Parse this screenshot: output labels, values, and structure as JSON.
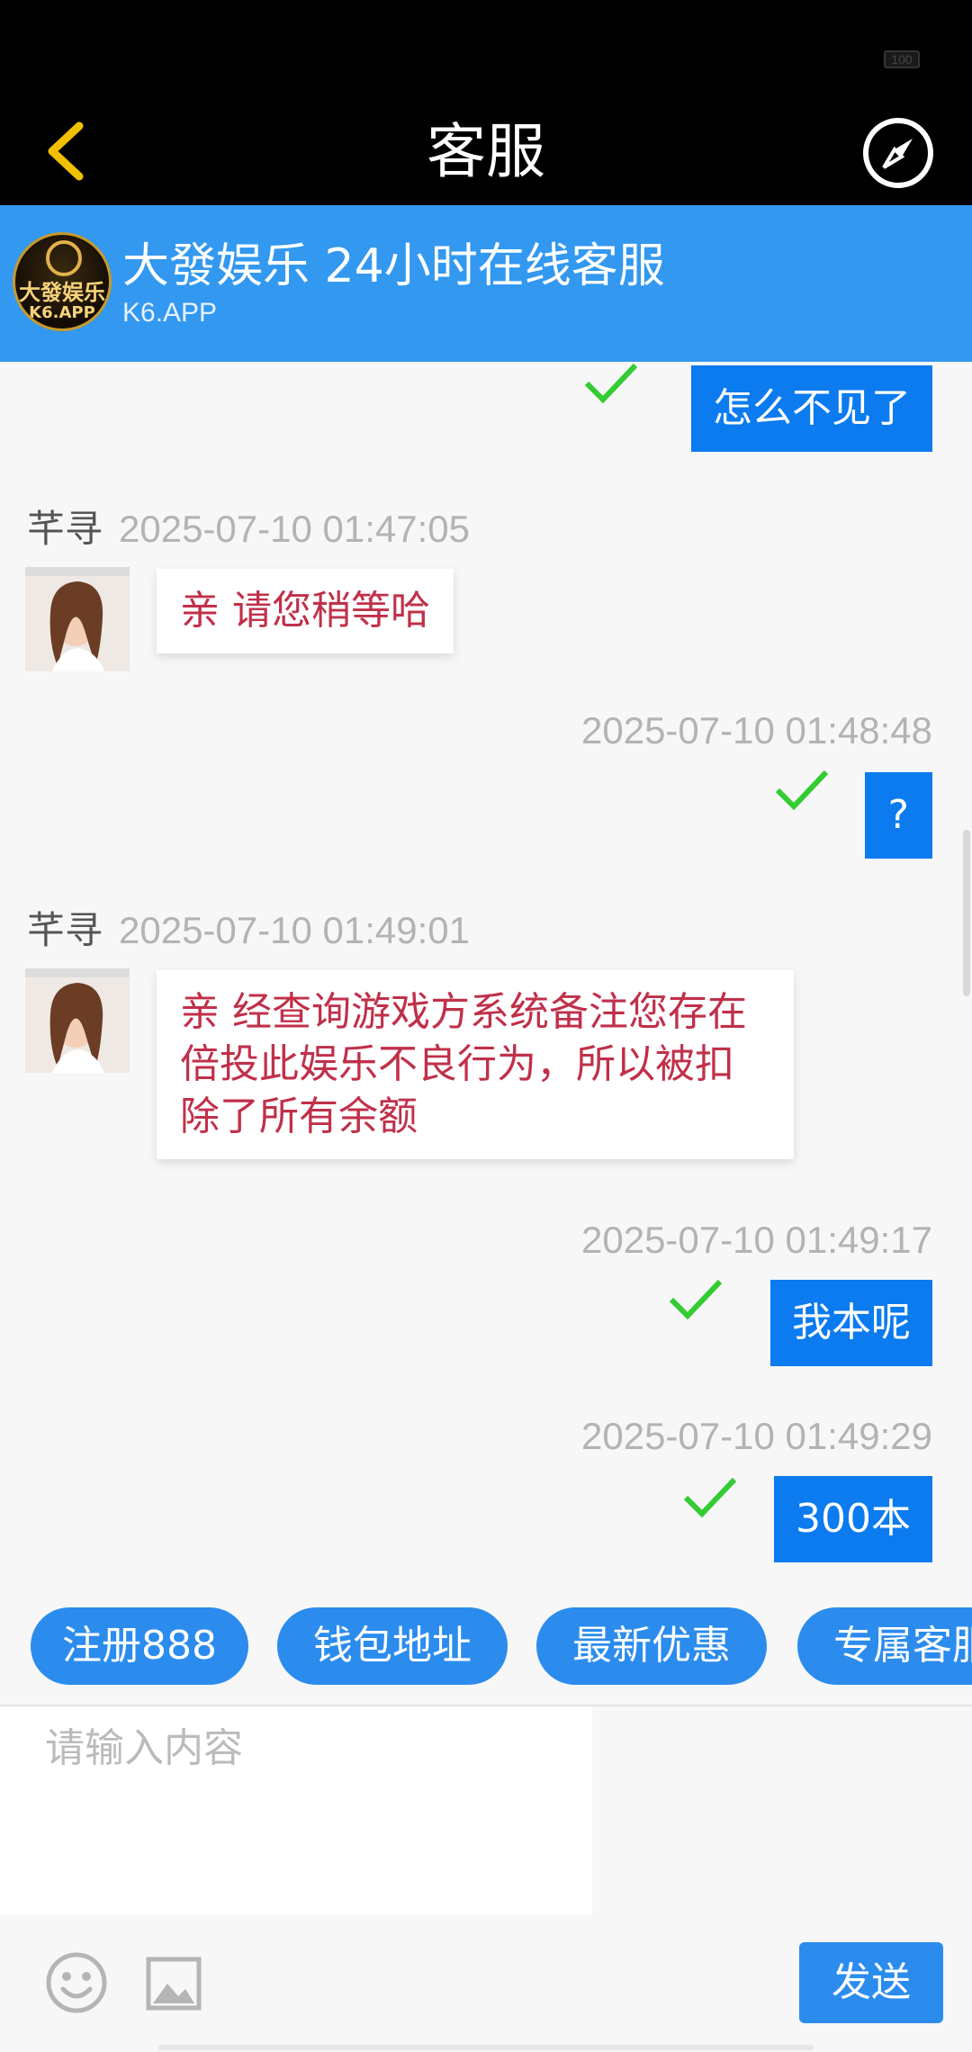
{
  "status_bar": {
    "battery": "100"
  },
  "nav": {
    "title": "客服"
  },
  "header": {
    "title": "大發娱乐 24小时在线客服",
    "subtitle": "K6.APP",
    "logo_text_top": "大發娱乐",
    "logo_text_bottom": "K6.APP"
  },
  "messages": [
    {
      "type": "outgoing",
      "text": "怎么不见了"
    },
    {
      "type": "incoming",
      "sender": "芊寻",
      "time": "2025-07-10 01:47:05",
      "text": "亲 请您稍等哈"
    },
    {
      "type": "outgoing",
      "time": "2025-07-10 01:48:48",
      "text": "?"
    },
    {
      "type": "incoming",
      "sender": "芊寻",
      "time": "2025-07-10 01:49:01",
      "lines": [
        "亲 经查询游戏方系统备注您存在",
        "倍投此娱乐不良行为，所以被扣",
        "除了所有余额"
      ]
    },
    {
      "type": "outgoing",
      "time": "2025-07-10 01:49:17",
      "text": "我本呢"
    },
    {
      "type": "outgoing",
      "time": "2025-07-10 01:49:29",
      "text": "300本"
    }
  ],
  "quick_replies": [
    "注册888",
    "钱包地址",
    "最新优惠",
    "专属客服"
  ],
  "input": {
    "placeholder": "请输入内容"
  },
  "send_label": "发送",
  "colors": {
    "header_bg": "#3398f0",
    "out_bubble": "#0b7bef",
    "in_text": "#c0304a",
    "check": "#33cc33",
    "quick_btn": "#2b8cee"
  },
  "icons": [
    "back-chevron-icon",
    "compass-icon",
    "check-icon",
    "emoji-icon",
    "image-icon"
  ]
}
